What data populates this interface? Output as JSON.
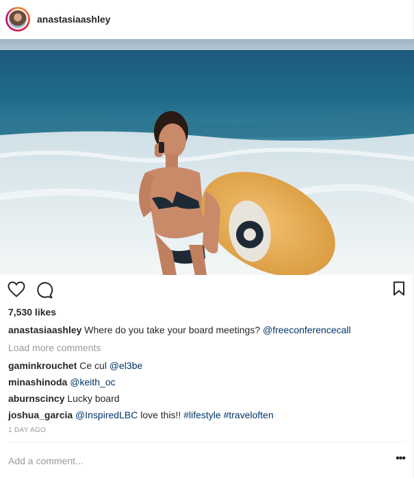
{
  "header": {
    "username": "anastasiaashley"
  },
  "actions": {
    "like_icon": "heart-icon",
    "comment_icon": "comment-icon",
    "save_icon": "bookmark-icon"
  },
  "likes": "7,530 likes",
  "caption": {
    "username": "anastasiaashley",
    "text": "Where do you take your board meetings?",
    "mention": "@freeconferencecall"
  },
  "load_more": "Load more comments",
  "comments": [
    {
      "username": "gaminkrouchet",
      "text": "Ce cul",
      "mention": "@el3be"
    },
    {
      "username": "minashinoda",
      "text": "",
      "mention": "@keith_oc"
    },
    {
      "username": "aburnscincy",
      "text": "Lucky board",
      "mention": ""
    },
    {
      "username": "joshua_garcia",
      "text": "love this!!",
      "mention": "@InspiredLBC",
      "tags": "#lifestyle #traveloften"
    }
  ],
  "timestamp": "1 DAY AGO",
  "add_comment_placeholder": "Add a comment...",
  "more_label": "•••",
  "colors": {
    "link": "#003569",
    "muted": "#999999",
    "text": "#262626"
  }
}
